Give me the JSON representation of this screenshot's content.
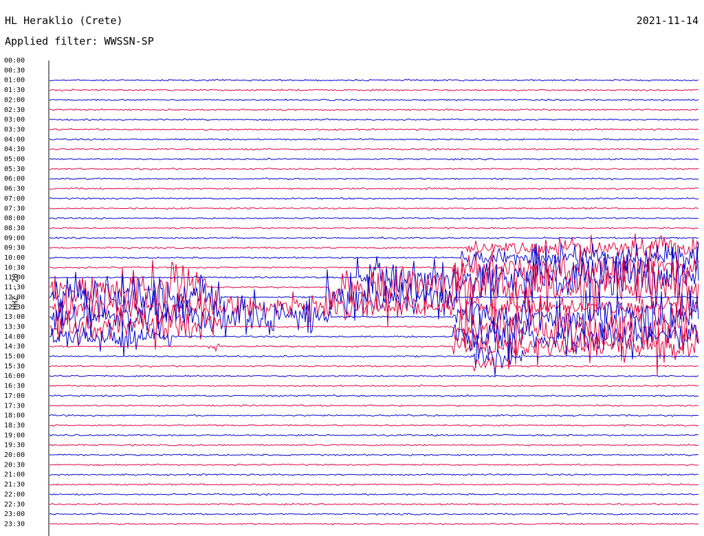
{
  "header": {
    "station": "HL Heraklio (Crete)",
    "date": "2021-11-14",
    "filter": "Applied filter: WWSSN-SP"
  },
  "chart_data": {
    "type": "line",
    "title": "HL Heraklio (Crete)",
    "ylabel": "HHZ - 20",
    "colors": {
      "even_rows": "#0000cc",
      "odd_rows": "#e0003c"
    },
    "y_tick_labels": [
      "00:00",
      "00:30",
      "01:00",
      "01:30",
      "02:00",
      "02:30",
      "03:00",
      "03:30",
      "04:00",
      "04:30",
      "05:00",
      "05:30",
      "06:00",
      "06:30",
      "07:00",
      "07:30",
      "08:00",
      "08:30",
      "09:00",
      "09:30",
      "10:00",
      "10:30",
      "11:00",
      "11:30",
      "12:00",
      "12:30",
      "13:00",
      "13:30",
      "14:00",
      "14:30",
      "15:00",
      "15:30",
      "16:00",
      "16:30",
      "17:00",
      "17:30",
      "18:00",
      "18:30",
      "19:00",
      "19:30",
      "20:00",
      "20:30",
      "21:00",
      "21:30",
      "22:00",
      "22:30",
      "23:00",
      "23:30"
    ],
    "grid": false,
    "legend": "none"
  }
}
